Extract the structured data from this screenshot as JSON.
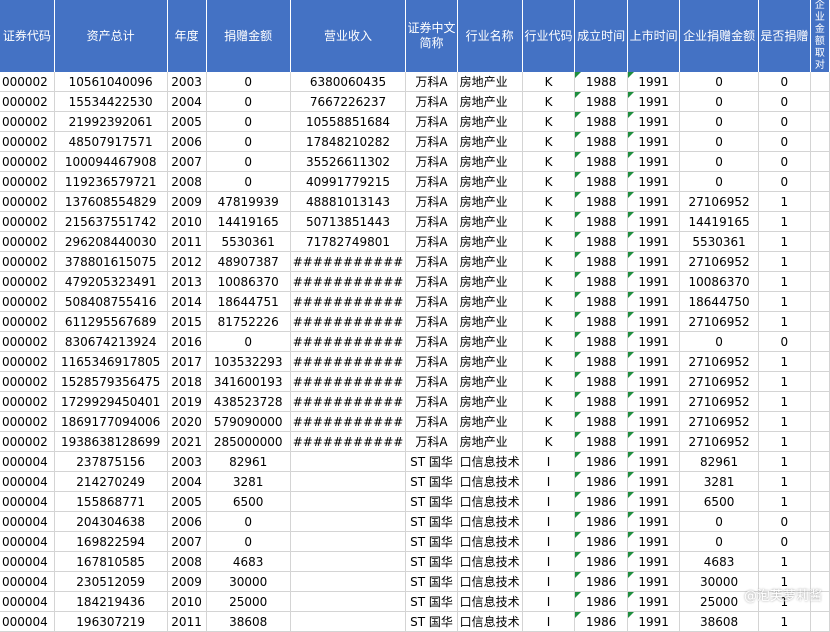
{
  "headers": [
    "证券代码",
    "资产总计",
    "年度",
    "捐赠金额",
    "营业收入",
    "证券中文简称",
    "行业名称",
    "行业代码",
    "成立时间",
    "上市时间",
    "企业捐赠金额",
    "是否捐赠",
    "企业捐赠金额取对数"
  ],
  "header_display": [
    "证券代码",
    "资产总计",
    "年度",
    "捐赠金额",
    "营业收入",
    "证券中文\n简称",
    "行业名称",
    "行业代码",
    "成立时间",
    "上市时间",
    "企业捐赠金额",
    "是否捐赠",
    "企业\n金额\n取对"
  ],
  "rows": [
    {
      "code": "000002",
      "assets": "10561040096",
      "year": "2003",
      "donation": "0",
      "revenue": "6380060435",
      "name": "万科A",
      "industry": "房地产业",
      "icode": "K",
      "founded": "1988",
      "listed": "1991",
      "corp_donation": "0",
      "is_donate": "0"
    },
    {
      "code": "000002",
      "assets": "15534422530",
      "year": "2004",
      "donation": "0",
      "revenue": "7667226237",
      "name": "万科A",
      "industry": "房地产业",
      "icode": "K",
      "founded": "1988",
      "listed": "1991",
      "corp_donation": "0",
      "is_donate": "0"
    },
    {
      "code": "000002",
      "assets": "21992392061",
      "year": "2005",
      "donation": "0",
      "revenue": "10558851684",
      "name": "万科A",
      "industry": "房地产业",
      "icode": "K",
      "founded": "1988",
      "listed": "1991",
      "corp_donation": "0",
      "is_donate": "0"
    },
    {
      "code": "000002",
      "assets": "48507917571",
      "year": "2006",
      "donation": "0",
      "revenue": "17848210282",
      "name": "万科A",
      "industry": "房地产业",
      "icode": "K",
      "founded": "1988",
      "listed": "1991",
      "corp_donation": "0",
      "is_donate": "0"
    },
    {
      "code": "000002",
      "assets": "100094467908",
      "year": "2007",
      "donation": "0",
      "revenue": "35526611302",
      "name": "万科A",
      "industry": "房地产业",
      "icode": "K",
      "founded": "1988",
      "listed": "1991",
      "corp_donation": "0",
      "is_donate": "0"
    },
    {
      "code": "000002",
      "assets": "119236579721",
      "year": "2008",
      "donation": "0",
      "revenue": "40991779215",
      "name": "万科A",
      "industry": "房地产业",
      "icode": "K",
      "founded": "1988",
      "listed": "1991",
      "corp_donation": "0",
      "is_donate": "0"
    },
    {
      "code": "000002",
      "assets": "137608554829",
      "year": "2009",
      "donation": "47819939",
      "revenue": "48881013143",
      "name": "万科A",
      "industry": "房地产业",
      "icode": "K",
      "founded": "1988",
      "listed": "1991",
      "corp_donation": "27106952",
      "is_donate": "1"
    },
    {
      "code": "000002",
      "assets": "215637551742",
      "year": "2010",
      "donation": "14419165",
      "revenue": "50713851443",
      "name": "万科A",
      "industry": "房地产业",
      "icode": "K",
      "founded": "1988",
      "listed": "1991",
      "corp_donation": "14419165",
      "is_donate": "1"
    },
    {
      "code": "000002",
      "assets": "296208440030",
      "year": "2011",
      "donation": "5530361",
      "revenue": "71782749801",
      "name": "万科A",
      "industry": "房地产业",
      "icode": "K",
      "founded": "1988",
      "listed": "1991",
      "corp_donation": "5530361",
      "is_donate": "1"
    },
    {
      "code": "000002",
      "assets": "378801615075",
      "year": "2012",
      "donation": "48907387",
      "revenue": "###########",
      "name": "万科A",
      "industry": "房地产业",
      "icode": "K",
      "founded": "1988",
      "listed": "1991",
      "corp_donation": "27106952",
      "is_donate": "1"
    },
    {
      "code": "000002",
      "assets": "479205323491",
      "year": "2013",
      "donation": "10086370",
      "revenue": "###########",
      "name": "万科A",
      "industry": "房地产业",
      "icode": "K",
      "founded": "1988",
      "listed": "1991",
      "corp_donation": "10086370",
      "is_donate": "1"
    },
    {
      "code": "000002",
      "assets": "508408755416",
      "year": "2014",
      "donation": "18644751",
      "revenue": "###########",
      "name": "万科A",
      "industry": "房地产业",
      "icode": "K",
      "founded": "1988",
      "listed": "1991",
      "corp_donation": "18644750",
      "is_donate": "1"
    },
    {
      "code": "000002",
      "assets": "611295567689",
      "year": "2015",
      "donation": "81752226",
      "revenue": "###########",
      "name": "万科A",
      "industry": "房地产业",
      "icode": "K",
      "founded": "1988",
      "listed": "1991",
      "corp_donation": "27106952",
      "is_donate": "1"
    },
    {
      "code": "000002",
      "assets": "830674213924",
      "year": "2016",
      "donation": "0",
      "revenue": "###########",
      "name": "万科A",
      "industry": "房地产业",
      "icode": "K",
      "founded": "1988",
      "listed": "1991",
      "corp_donation": "0",
      "is_donate": "0"
    },
    {
      "code": "000002",
      "assets": "1165346917805",
      "year": "2017",
      "donation": "103532293",
      "revenue": "###########",
      "name": "万科A",
      "industry": "房地产业",
      "icode": "K",
      "founded": "1988",
      "listed": "1991",
      "corp_donation": "27106952",
      "is_donate": "1"
    },
    {
      "code": "000002",
      "assets": "1528579356475",
      "year": "2018",
      "donation": "341600193",
      "revenue": "###########",
      "name": "万科A",
      "industry": "房地产业",
      "icode": "K",
      "founded": "1988",
      "listed": "1991",
      "corp_donation": "27106952",
      "is_donate": "1"
    },
    {
      "code": "000002",
      "assets": "1729929450401",
      "year": "2019",
      "donation": "438523728",
      "revenue": "###########",
      "name": "万科A",
      "industry": "房地产业",
      "icode": "K",
      "founded": "1988",
      "listed": "1991",
      "corp_donation": "27106952",
      "is_donate": "1"
    },
    {
      "code": "000002",
      "assets": "1869177094006",
      "year": "2020",
      "donation": "579090000",
      "revenue": "###########",
      "name": "万科A",
      "industry": "房地产业",
      "icode": "K",
      "founded": "1988",
      "listed": "1991",
      "corp_donation": "27106952",
      "is_donate": "1"
    },
    {
      "code": "000002",
      "assets": "1938638128699",
      "year": "2021",
      "donation": "285000000",
      "revenue": "###########",
      "name": "万科A",
      "industry": "房地产业",
      "icode": "K",
      "founded": "1988",
      "listed": "1991",
      "corp_donation": "27106952",
      "is_donate": "1"
    },
    {
      "code": "000004",
      "assets": "237875156",
      "year": "2003",
      "donation": "82961",
      "revenue": "",
      "name": "ST 国华",
      "industry": "口信息技术",
      "icode": "I",
      "founded": "1986",
      "listed": "1991",
      "corp_donation": "82961",
      "is_donate": "1"
    },
    {
      "code": "000004",
      "assets": "214270249",
      "year": "2004",
      "donation": "3281",
      "revenue": "",
      "name": "ST 国华",
      "industry": "口信息技术",
      "icode": "I",
      "founded": "1986",
      "listed": "1991",
      "corp_donation": "3281",
      "is_donate": "1"
    },
    {
      "code": "000004",
      "assets": "155868771",
      "year": "2005",
      "donation": "6500",
      "revenue": "",
      "name": "ST 国华",
      "industry": "口信息技术",
      "icode": "I",
      "founded": "1986",
      "listed": "1991",
      "corp_donation": "6500",
      "is_donate": "1"
    },
    {
      "code": "000004",
      "assets": "204304638",
      "year": "2006",
      "donation": "0",
      "revenue": "",
      "name": "ST 国华",
      "industry": "口信息技术",
      "icode": "I",
      "founded": "1986",
      "listed": "1991",
      "corp_donation": "0",
      "is_donate": "0"
    },
    {
      "code": "000004",
      "assets": "169822594",
      "year": "2007",
      "donation": "0",
      "revenue": "",
      "name": "ST 国华",
      "industry": "口信息技术",
      "icode": "I",
      "founded": "1986",
      "listed": "1991",
      "corp_donation": "0",
      "is_donate": "0"
    },
    {
      "code": "000004",
      "assets": "167810585",
      "year": "2008",
      "donation": "4683",
      "revenue": "",
      "name": "ST 国华",
      "industry": "口信息技术",
      "icode": "I",
      "founded": "1986",
      "listed": "1991",
      "corp_donation": "4683",
      "is_donate": "1"
    },
    {
      "code": "000004",
      "assets": "230512059",
      "year": "2009",
      "donation": "30000",
      "revenue": "",
      "name": "ST 国华",
      "industry": "口信息技术",
      "icode": "I",
      "founded": "1986",
      "listed": "1991",
      "corp_donation": "30000",
      "is_donate": "1"
    },
    {
      "code": "000004",
      "assets": "184219436",
      "year": "2010",
      "donation": "25000",
      "revenue": "",
      "name": "ST 国华",
      "industry": "口信息技术",
      "icode": "I",
      "founded": "1986",
      "listed": "1991",
      "corp_donation": "25000",
      "is_donate": "1"
    },
    {
      "code": "000004",
      "assets": "196307219",
      "year": "2011",
      "donation": "38608",
      "revenue": "",
      "name": "ST 国华",
      "industry": "口信息技术",
      "icode": "I",
      "founded": "1986",
      "listed": "1991",
      "corp_donation": "38608",
      "is_donate": "1"
    }
  ],
  "watermark": "@泡芙萝莉酱",
  "colors": {
    "header_bg": "#4472c4",
    "flag_green": "#1e8e3e"
  }
}
